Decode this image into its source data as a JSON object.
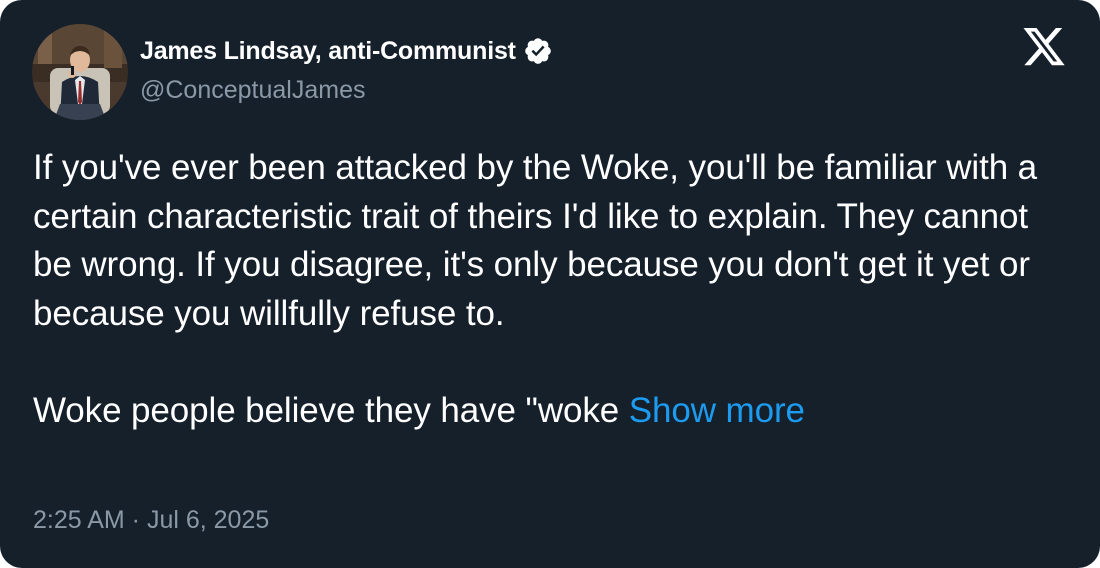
{
  "author": {
    "display_name": "James Lindsay, anti-Communist",
    "handle": "@ConceptualJames",
    "verified": true,
    "avatar_icon": "profile-photo-man-in-suit-with-microphone"
  },
  "platform": {
    "logo_icon": "x-logo-icon"
  },
  "tweet": {
    "paragraph_1": "If you've ever been attacked by the Woke, you'll be familiar with a certain characteristic trait of theirs I'd like to explain. They cannot be wrong. If you disagree, it's only because you don't get it yet or because you willfully refuse to.",
    "paragraph_2": "Woke people believe they have \"woke",
    "show_more_label": "Show more"
  },
  "meta": {
    "timestamp": "2:25 AM · Jul 6, 2025"
  },
  "colors": {
    "background": "#15202b",
    "text_primary": "#ffffff",
    "text_secondary": "#8b98a5",
    "link": "#1d9bf0",
    "verified_badge": "#ffffff"
  }
}
